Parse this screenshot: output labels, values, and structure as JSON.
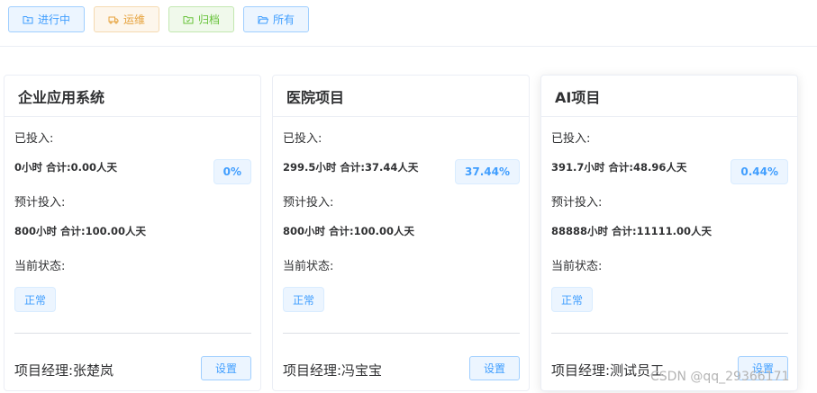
{
  "filters": [
    {
      "label": "进行中",
      "icon": "folder-add-icon",
      "color": "#409eff"
    },
    {
      "label": "运维",
      "icon": "truck-icon",
      "color": "#e6a23c"
    },
    {
      "label": "归档",
      "icon": "folder-checked-icon",
      "color": "#67c23a"
    },
    {
      "label": "所有",
      "icon": "folder-opened-icon",
      "color": "#409eff"
    }
  ],
  "labels": {
    "invested": "已投入:",
    "planned": "预计投入:",
    "status": "当前状态:",
    "manager_prefix": "项目经理:"
  },
  "cards": [
    {
      "title": "企业应用系统",
      "invested_value": "0小时 合计:0.00人天",
      "percent": "0%",
      "planned_value": "800小时 合计:100.00人天",
      "status": "正常",
      "manager": "项目经理:张楚岚",
      "settings_label": "设置"
    },
    {
      "title": "医院项目",
      "invested_value": "299.5小时 合计:37.44人天",
      "percent": "37.44%",
      "planned_value": "800小时 合计:100.00人天",
      "status": "正常",
      "manager": "项目经理:冯宝宝",
      "settings_label": "设置"
    },
    {
      "title": "AI项目",
      "invested_value": "391.7小时 合计:48.96人天",
      "percent": "0.44%",
      "planned_value": "88888小时 合计:11111.00人天",
      "status": "正常",
      "manager": "项目经理:测试员工",
      "settings_label": "设置"
    }
  ],
  "watermark": "CSDN @qq_29366171"
}
